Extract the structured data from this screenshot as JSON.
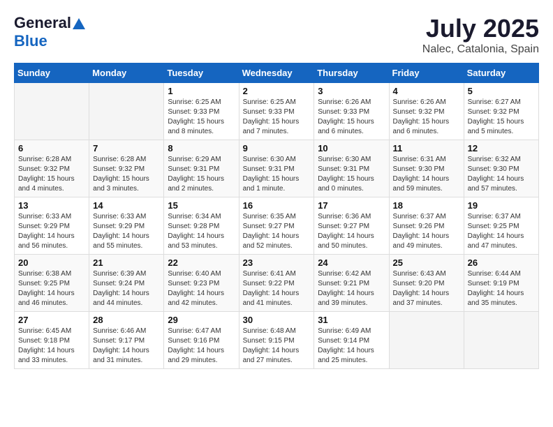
{
  "header": {
    "logo_general": "General",
    "logo_blue": "Blue",
    "title": "July 2025",
    "subtitle": "Nalec, Catalonia, Spain"
  },
  "weekdays": [
    "Sunday",
    "Monday",
    "Tuesday",
    "Wednesday",
    "Thursday",
    "Friday",
    "Saturday"
  ],
  "weeks": [
    [
      {
        "day": "",
        "info": ""
      },
      {
        "day": "",
        "info": ""
      },
      {
        "day": "1",
        "info": "Sunrise: 6:25 AM\nSunset: 9:33 PM\nDaylight: 15 hours\nand 8 minutes."
      },
      {
        "day": "2",
        "info": "Sunrise: 6:25 AM\nSunset: 9:33 PM\nDaylight: 15 hours\nand 7 minutes."
      },
      {
        "day": "3",
        "info": "Sunrise: 6:26 AM\nSunset: 9:33 PM\nDaylight: 15 hours\nand 6 minutes."
      },
      {
        "day": "4",
        "info": "Sunrise: 6:26 AM\nSunset: 9:32 PM\nDaylight: 15 hours\nand 6 minutes."
      },
      {
        "day": "5",
        "info": "Sunrise: 6:27 AM\nSunset: 9:32 PM\nDaylight: 15 hours\nand 5 minutes."
      }
    ],
    [
      {
        "day": "6",
        "info": "Sunrise: 6:28 AM\nSunset: 9:32 PM\nDaylight: 15 hours\nand 4 minutes."
      },
      {
        "day": "7",
        "info": "Sunrise: 6:28 AM\nSunset: 9:32 PM\nDaylight: 15 hours\nand 3 minutes."
      },
      {
        "day": "8",
        "info": "Sunrise: 6:29 AM\nSunset: 9:31 PM\nDaylight: 15 hours\nand 2 minutes."
      },
      {
        "day": "9",
        "info": "Sunrise: 6:30 AM\nSunset: 9:31 PM\nDaylight: 15 hours\nand 1 minute."
      },
      {
        "day": "10",
        "info": "Sunrise: 6:30 AM\nSunset: 9:31 PM\nDaylight: 15 hours\nand 0 minutes."
      },
      {
        "day": "11",
        "info": "Sunrise: 6:31 AM\nSunset: 9:30 PM\nDaylight: 14 hours\nand 59 minutes."
      },
      {
        "day": "12",
        "info": "Sunrise: 6:32 AM\nSunset: 9:30 PM\nDaylight: 14 hours\nand 57 minutes."
      }
    ],
    [
      {
        "day": "13",
        "info": "Sunrise: 6:33 AM\nSunset: 9:29 PM\nDaylight: 14 hours\nand 56 minutes."
      },
      {
        "day": "14",
        "info": "Sunrise: 6:33 AM\nSunset: 9:29 PM\nDaylight: 14 hours\nand 55 minutes."
      },
      {
        "day": "15",
        "info": "Sunrise: 6:34 AM\nSunset: 9:28 PM\nDaylight: 14 hours\nand 53 minutes."
      },
      {
        "day": "16",
        "info": "Sunrise: 6:35 AM\nSunset: 9:27 PM\nDaylight: 14 hours\nand 52 minutes."
      },
      {
        "day": "17",
        "info": "Sunrise: 6:36 AM\nSunset: 9:27 PM\nDaylight: 14 hours\nand 50 minutes."
      },
      {
        "day": "18",
        "info": "Sunrise: 6:37 AM\nSunset: 9:26 PM\nDaylight: 14 hours\nand 49 minutes."
      },
      {
        "day": "19",
        "info": "Sunrise: 6:37 AM\nSunset: 9:25 PM\nDaylight: 14 hours\nand 47 minutes."
      }
    ],
    [
      {
        "day": "20",
        "info": "Sunrise: 6:38 AM\nSunset: 9:25 PM\nDaylight: 14 hours\nand 46 minutes."
      },
      {
        "day": "21",
        "info": "Sunrise: 6:39 AM\nSunset: 9:24 PM\nDaylight: 14 hours\nand 44 minutes."
      },
      {
        "day": "22",
        "info": "Sunrise: 6:40 AM\nSunset: 9:23 PM\nDaylight: 14 hours\nand 42 minutes."
      },
      {
        "day": "23",
        "info": "Sunrise: 6:41 AM\nSunset: 9:22 PM\nDaylight: 14 hours\nand 41 minutes."
      },
      {
        "day": "24",
        "info": "Sunrise: 6:42 AM\nSunset: 9:21 PM\nDaylight: 14 hours\nand 39 minutes."
      },
      {
        "day": "25",
        "info": "Sunrise: 6:43 AM\nSunset: 9:20 PM\nDaylight: 14 hours\nand 37 minutes."
      },
      {
        "day": "26",
        "info": "Sunrise: 6:44 AM\nSunset: 9:19 PM\nDaylight: 14 hours\nand 35 minutes."
      }
    ],
    [
      {
        "day": "27",
        "info": "Sunrise: 6:45 AM\nSunset: 9:18 PM\nDaylight: 14 hours\nand 33 minutes."
      },
      {
        "day": "28",
        "info": "Sunrise: 6:46 AM\nSunset: 9:17 PM\nDaylight: 14 hours\nand 31 minutes."
      },
      {
        "day": "29",
        "info": "Sunrise: 6:47 AM\nSunset: 9:16 PM\nDaylight: 14 hours\nand 29 minutes."
      },
      {
        "day": "30",
        "info": "Sunrise: 6:48 AM\nSunset: 9:15 PM\nDaylight: 14 hours\nand 27 minutes."
      },
      {
        "day": "31",
        "info": "Sunrise: 6:49 AM\nSunset: 9:14 PM\nDaylight: 14 hours\nand 25 minutes."
      },
      {
        "day": "",
        "info": ""
      },
      {
        "day": "",
        "info": ""
      }
    ]
  ]
}
